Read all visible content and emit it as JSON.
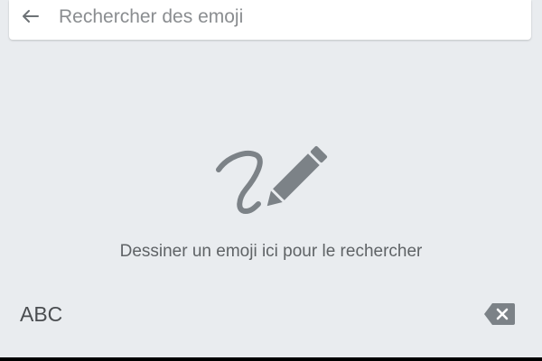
{
  "search": {
    "placeholder": "Rechercher des emoji",
    "value": "",
    "back_icon": "arrow-left-icon"
  },
  "draw_area": {
    "icon": "pencil-squiggle-icon",
    "hint": "Dessiner un emoji ici pour le rechercher"
  },
  "bottom_bar": {
    "abc_label": "ABC",
    "delete_icon": "backspace-icon"
  },
  "colors": {
    "background": "#e9ecef",
    "search_bar": "#ffffff",
    "icon": "#7c8287",
    "hint_text": "#5f6366"
  }
}
